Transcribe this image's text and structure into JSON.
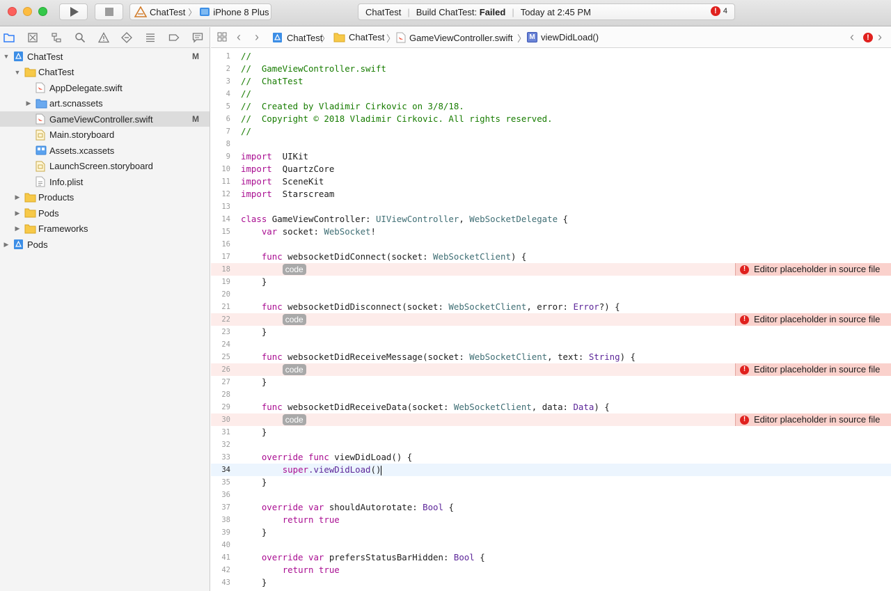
{
  "toolbar": {
    "scheme": "ChatTest",
    "device": "iPhone 8 Plus",
    "activity": {
      "project": "ChatTest",
      "build_prefix": "Build ChatTest:",
      "build_status": "Failed",
      "time": "Today at 2:45 PM",
      "error_count": "4"
    }
  },
  "navigator": {
    "items": [
      {
        "label": "ChatTest",
        "status": "M",
        "depth": 0,
        "kind": "project",
        "disclosure": "open"
      },
      {
        "label": "ChatTest",
        "status": "",
        "depth": 1,
        "kind": "folder",
        "disclosure": "open"
      },
      {
        "label": "AppDelegate.swift",
        "status": "",
        "depth": 2,
        "kind": "swift",
        "disclosure": ""
      },
      {
        "label": "art.scnassets",
        "status": "",
        "depth": 2,
        "kind": "folder-blue",
        "disclosure": "closed"
      },
      {
        "label": "GameViewController.swift",
        "status": "M",
        "depth": 2,
        "kind": "swift",
        "disclosure": "",
        "selected": true
      },
      {
        "label": "Main.storyboard",
        "status": "",
        "depth": 2,
        "kind": "storyboard",
        "disclosure": ""
      },
      {
        "label": "Assets.xcassets",
        "status": "",
        "depth": 2,
        "kind": "assets",
        "disclosure": ""
      },
      {
        "label": "LaunchScreen.storyboard",
        "status": "",
        "depth": 2,
        "kind": "storyboard",
        "disclosure": ""
      },
      {
        "label": "Info.plist",
        "status": "",
        "depth": 2,
        "kind": "plist",
        "disclosure": ""
      },
      {
        "label": "Products",
        "status": "",
        "depth": 1,
        "kind": "folder",
        "disclosure": "closed"
      },
      {
        "label": "Pods",
        "status": "",
        "depth": 1,
        "kind": "folder",
        "disclosure": "closed"
      },
      {
        "label": "Frameworks",
        "status": "",
        "depth": 1,
        "kind": "folder",
        "disclosure": "closed"
      },
      {
        "label": "Pods",
        "status": "",
        "depth": 0,
        "kind": "project",
        "disclosure": "closed"
      }
    ]
  },
  "jumpbar": {
    "project": "ChatTest",
    "group": "ChatTest",
    "file": "GameViewController.swift",
    "method_badge": "M",
    "symbol": "viewDidLoad()"
  },
  "editor": {
    "placeholder_token": "code",
    "issue_message": "Editor placeholder in source file",
    "current_line": 34,
    "lines": [
      [
        [
          "cm",
          "//"
        ]
      ],
      [
        [
          "cm",
          "//  GameViewController.swift"
        ]
      ],
      [
        [
          "cm",
          "//  ChatTest"
        ]
      ],
      [
        [
          "cm",
          "//"
        ]
      ],
      [
        [
          "cm",
          "//  Created by Vladimir Cirkovic on 3/8/18."
        ]
      ],
      [
        [
          "cm",
          "//  Copyright © 2018 Vladimir Cirkovic. All rights reserved."
        ]
      ],
      [
        [
          "cm",
          "//"
        ]
      ],
      [],
      [
        [
          "kw",
          "import"
        ],
        [
          "",
          "  UIKit"
        ]
      ],
      [
        [
          "kw",
          "import"
        ],
        [
          "",
          "  QuartzCore"
        ]
      ],
      [
        [
          "kw",
          "import"
        ],
        [
          "",
          "  SceneKit"
        ]
      ],
      [
        [
          "kw",
          "import"
        ],
        [
          "",
          "  Starscream"
        ]
      ],
      [],
      [
        [
          "kw",
          "class"
        ],
        [
          "",
          " GameViewController: "
        ],
        [
          "ty",
          "UIViewController"
        ],
        [
          "",
          ", "
        ],
        [
          "ty",
          "WebSocketDelegate"
        ],
        [
          "",
          " {"
        ]
      ],
      [
        [
          "",
          "    "
        ],
        [
          "kw",
          "var"
        ],
        [
          "",
          " socket: "
        ],
        [
          "ty",
          "WebSocket"
        ],
        [
          "",
          "!"
        ]
      ],
      [],
      [
        [
          "",
          "    "
        ],
        [
          "kw",
          "func"
        ],
        [
          "",
          " websocketDidConnect(socket: "
        ],
        [
          "ty",
          "WebSocketClient"
        ],
        [
          "",
          ") {"
        ]
      ],
      [
        [
          "",
          "        "
        ],
        [
          "ph",
          "code"
        ]
      ],
      [
        [
          "",
          "    }"
        ]
      ],
      [],
      [
        [
          "",
          "    "
        ],
        [
          "kw",
          "func"
        ],
        [
          "",
          " websocketDidDisconnect(socket: "
        ],
        [
          "ty",
          "WebSocketClient"
        ],
        [
          "",
          ", error: "
        ],
        [
          "sy",
          "Error"
        ],
        [
          "",
          "?) {"
        ]
      ],
      [
        [
          "",
          "        "
        ],
        [
          "ph",
          "code"
        ]
      ],
      [
        [
          "",
          "    }"
        ]
      ],
      [],
      [
        [
          "",
          "    "
        ],
        [
          "kw",
          "func"
        ],
        [
          "",
          " websocketDidReceiveMessage(socket: "
        ],
        [
          "ty",
          "WebSocketClient"
        ],
        [
          "",
          ", text: "
        ],
        [
          "sy",
          "String"
        ],
        [
          "",
          ") {"
        ]
      ],
      [
        [
          "",
          "        "
        ],
        [
          "ph",
          "code"
        ]
      ],
      [
        [
          "",
          "    }"
        ]
      ],
      [],
      [
        [
          "",
          "    "
        ],
        [
          "kw",
          "func"
        ],
        [
          "",
          " websocketDidReceiveData(socket: "
        ],
        [
          "ty",
          "WebSocketClient"
        ],
        [
          "",
          ", data: "
        ],
        [
          "sy",
          "Data"
        ],
        [
          "",
          ") {"
        ]
      ],
      [
        [
          "",
          "        "
        ],
        [
          "ph",
          "code"
        ]
      ],
      [
        [
          "",
          "    }"
        ]
      ],
      [],
      [
        [
          "",
          "    "
        ],
        [
          "kw",
          "override"
        ],
        [
          "",
          " "
        ],
        [
          "kw",
          "func"
        ],
        [
          "",
          " viewDidLoad() {"
        ]
      ],
      [
        [
          "",
          "        "
        ],
        [
          "kw",
          "super"
        ],
        [
          "sy",
          ".viewDidLoad"
        ],
        [
          "",
          "()"
        ],
        [
          "caret",
          ""
        ]
      ],
      [
        [
          "",
          "    }"
        ]
      ],
      [],
      [
        [
          "",
          "    "
        ],
        [
          "kw",
          "override"
        ],
        [
          "",
          " "
        ],
        [
          "kw",
          "var"
        ],
        [
          "",
          " shouldAutorotate: "
        ],
        [
          "sy",
          "Bool"
        ],
        [
          "",
          " {"
        ]
      ],
      [
        [
          "",
          "        "
        ],
        [
          "kw",
          "return"
        ],
        [
          "",
          " "
        ],
        [
          "kw",
          "true"
        ]
      ],
      [
        [
          "",
          "    }"
        ]
      ],
      [],
      [
        [
          "",
          "    "
        ],
        [
          "kw",
          "override"
        ],
        [
          "",
          " "
        ],
        [
          "kw",
          "var"
        ],
        [
          "",
          " prefersStatusBarHidden: "
        ],
        [
          "sy",
          "Bool"
        ],
        [
          "",
          " {"
        ]
      ],
      [
        [
          "",
          "        "
        ],
        [
          "kw",
          "return"
        ],
        [
          "",
          " "
        ],
        [
          "kw",
          "true"
        ]
      ],
      [
        [
          "",
          "    }"
        ]
      ]
    ],
    "error_lines": [
      18,
      22,
      26,
      30
    ]
  }
}
